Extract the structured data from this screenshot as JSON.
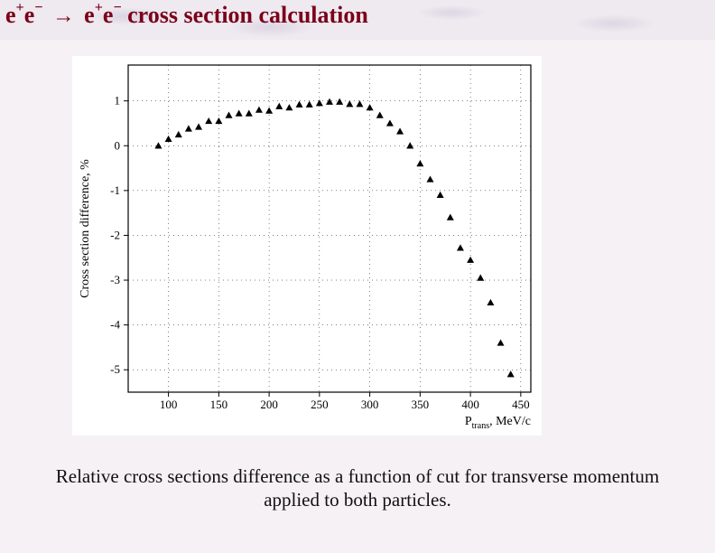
{
  "title": {
    "lhs_base1": "e",
    "lhs_sup1": "+",
    "lhs_base2": "e",
    "lhs_sup2": "−",
    "arrow": "→",
    "rhs_base1": "e",
    "rhs_sup1": "+",
    "rhs_base2": "e",
    "rhs_sup2": "−",
    "rest": " cross section calculation"
  },
  "caption": "Relative cross sections difference as a function of cut for transverse momentum applied to both particles.",
  "chart_data": {
    "type": "scatter",
    "title": "",
    "xlabel": "P_trans, MeV/c",
    "ylabel": "Cross section difference, %",
    "xlim": [
      60,
      460
    ],
    "ylim": [
      -5.5,
      1.8
    ],
    "xticks": [
      100,
      150,
      200,
      250,
      300,
      350,
      400,
      450
    ],
    "yticks": [
      -5,
      -4,
      -3,
      -2,
      -1,
      0,
      1
    ],
    "grid": true,
    "series": [
      {
        "name": "diff",
        "marker": "triangle",
        "x": [
          90,
          100,
          110,
          120,
          130,
          140,
          150,
          160,
          170,
          180,
          190,
          200,
          210,
          220,
          230,
          240,
          250,
          260,
          270,
          280,
          290,
          300,
          310,
          320,
          330,
          340,
          350,
          360,
          370,
          380,
          390,
          400,
          410,
          420,
          430,
          440
        ],
        "y": [
          0.0,
          0.15,
          0.25,
          0.38,
          0.42,
          0.55,
          0.55,
          0.68,
          0.72,
          0.72,
          0.8,
          0.78,
          0.88,
          0.85,
          0.92,
          0.92,
          0.95,
          0.98,
          0.98,
          0.93,
          0.93,
          0.85,
          0.68,
          0.5,
          0.32,
          0.0,
          -0.4,
          -0.75,
          -1.1,
          -1.6,
          -2.28,
          -2.55,
          -2.95,
          -3.5,
          -4.4,
          -5.1
        ]
      }
    ]
  }
}
